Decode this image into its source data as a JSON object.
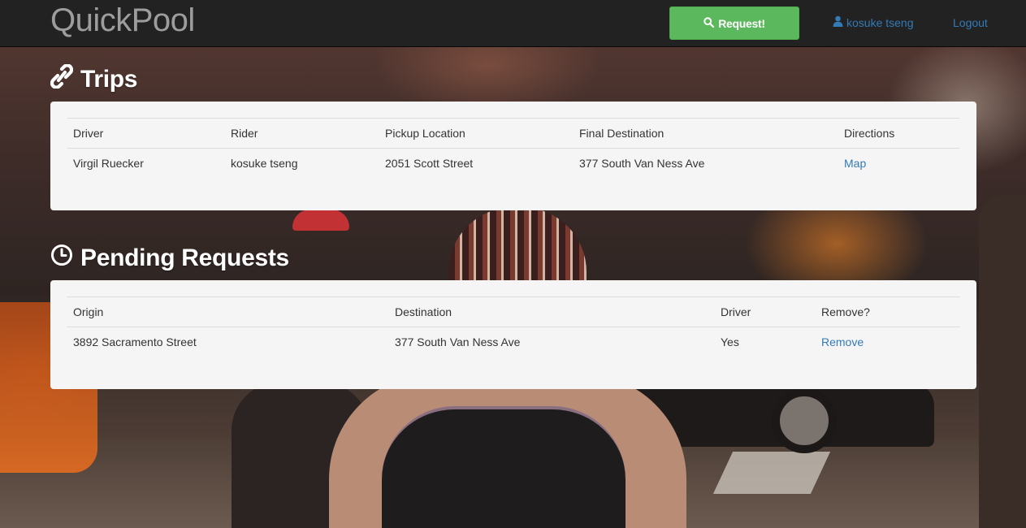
{
  "navbar": {
    "brand": "QuickPool",
    "request_button": "Request!",
    "user_name": "kosuke tseng",
    "logout": "Logout"
  },
  "trips": {
    "title": "Trips",
    "icon": "link-icon",
    "columns": [
      "Driver",
      "Rider",
      "Pickup Location",
      "Final Destination",
      "Directions"
    ],
    "rows": [
      {
        "driver": "Virgil Ruecker",
        "rider": "kosuke tseng",
        "pickup": "2051 Scott Street",
        "destination": "377 South Van Ness Ave",
        "directions": "Map"
      }
    ]
  },
  "pending": {
    "title": "Pending Requests",
    "icon": "clock-icon",
    "columns": [
      "Origin",
      "Destination",
      "Driver",
      "Remove?"
    ],
    "rows": [
      {
        "origin": "3892 Sacramento Street",
        "destination": "377 South Van Ness Ave",
        "driver": "Yes",
        "remove": "Remove"
      }
    ]
  },
  "colors": {
    "navbar_bg": "#222222",
    "brand_color": "#9d9d9d",
    "success": "#5cb85c",
    "link": "#337ab7",
    "panel_bg": "#f5f5f5"
  }
}
